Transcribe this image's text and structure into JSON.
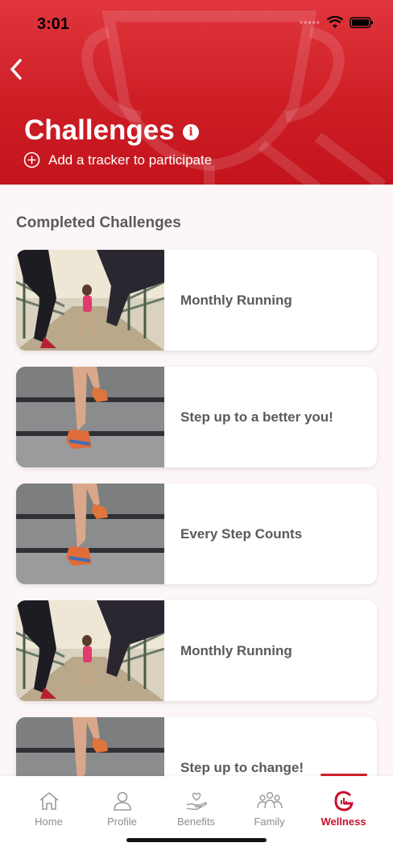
{
  "status": {
    "time": "3:01",
    "dots": "•••••"
  },
  "header": {
    "title": "Challenges",
    "info_glyph": "i",
    "add_tracker_label": "Add a tracker to participate"
  },
  "section": {
    "title": "Completed Challenges"
  },
  "challenges": [
    {
      "label": "Monthly Running",
      "image": "runner-bridge-photo"
    },
    {
      "label": "Step up to a better you!",
      "image": "stairs-photo"
    },
    {
      "label": "Every Step Counts",
      "image": "stairs-photo"
    },
    {
      "label": "Monthly Running",
      "image": "runner-bridge-photo"
    },
    {
      "label": "Step up to change!",
      "image": "stairs-photo"
    }
  ],
  "tabs": [
    {
      "label": "Home",
      "icon": "home-icon"
    },
    {
      "label": "Profile",
      "icon": "profile-icon"
    },
    {
      "label": "Benefits",
      "icon": "benefits-icon"
    },
    {
      "label": "Family",
      "icon": "family-icon"
    },
    {
      "label": "Wellness",
      "icon": "wellness-icon",
      "active": true
    }
  ],
  "colors": {
    "brand": "#cc1c24",
    "active_tab": "#c8102e",
    "text": "#5a5a5a"
  }
}
